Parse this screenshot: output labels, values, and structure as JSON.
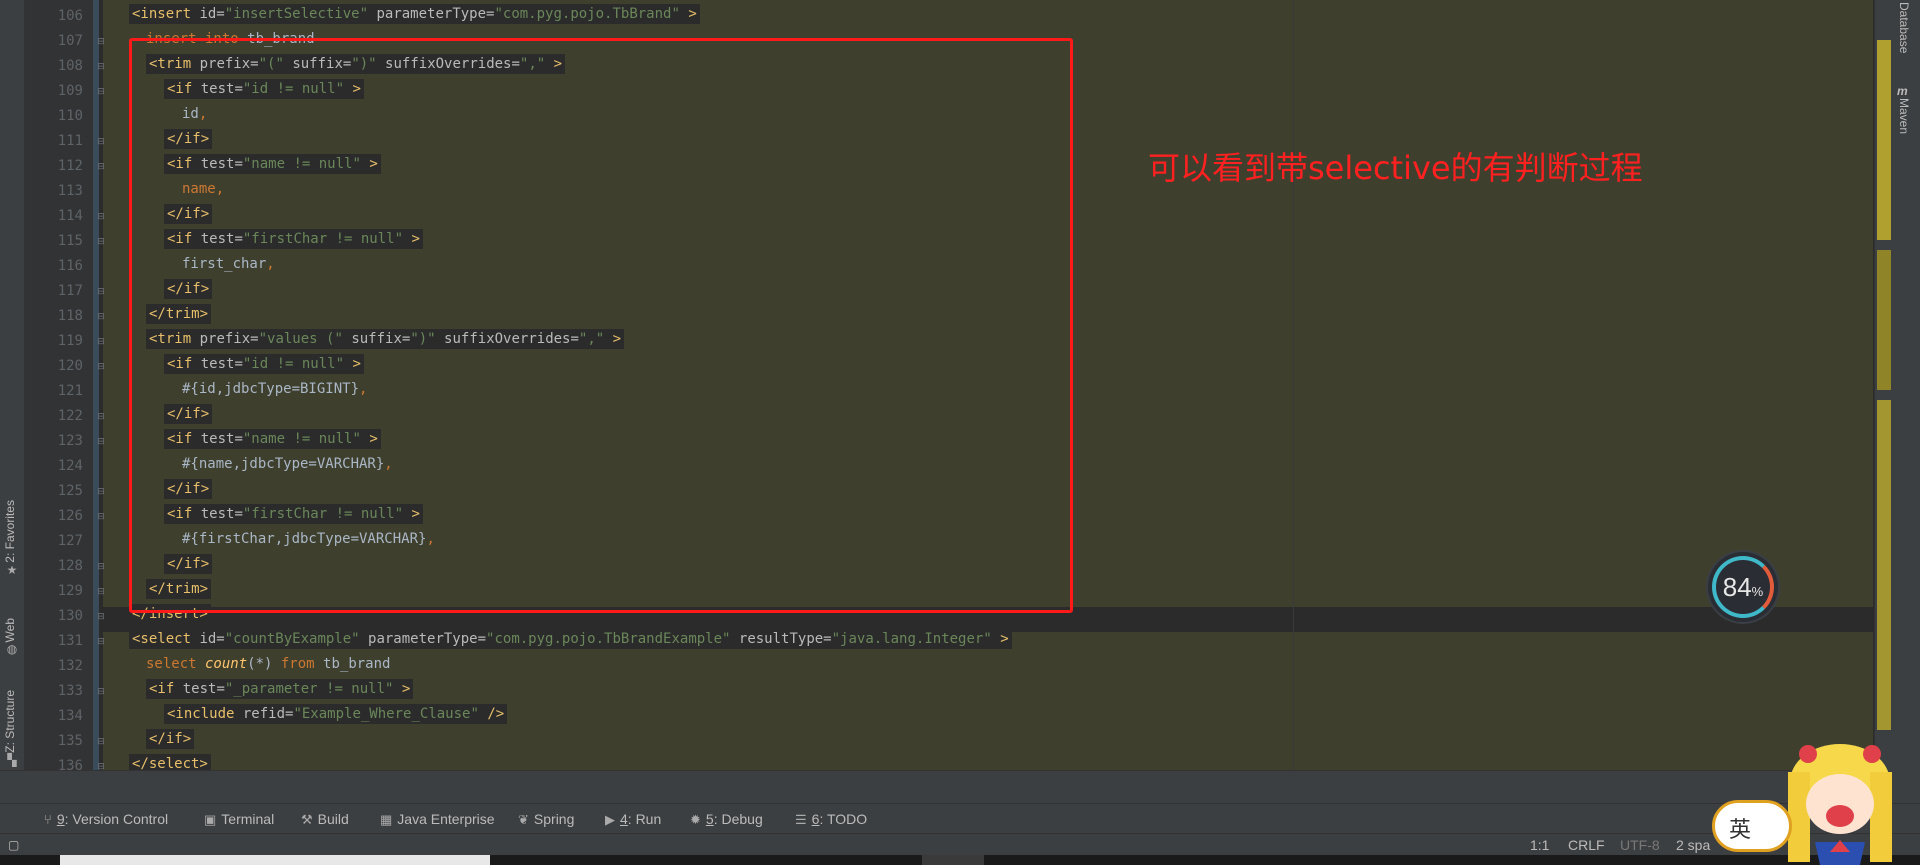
{
  "left_tool_tabs": [
    {
      "label": "2: Favorites",
      "icon": "star-icon"
    },
    {
      "label": "Web",
      "icon": "globe-icon"
    },
    {
      "label": "Z: Structure",
      "icon": "structure-icon"
    }
  ],
  "right_tool_tabs": [
    {
      "label": "Database",
      "icon": "database-icon"
    },
    {
      "label": "Maven",
      "icon": "maven-icon"
    }
  ],
  "line_numbers": [
    "106",
    "107",
    "108",
    "109",
    "110",
    "111",
    "112",
    "113",
    "114",
    "115",
    "116",
    "117",
    "118",
    "119",
    "120",
    "121",
    "122",
    "123",
    "124",
    "125",
    "126",
    "127",
    "128",
    "129",
    "130",
    "131",
    "132",
    "133",
    "134",
    "135",
    "136"
  ],
  "code": {
    "l106": {
      "a": "<insert",
      "b": " id=",
      "c": "\"insertSelective\"",
      "d": " parameterType=",
      "e": "\"com.pyg.pojo.TbBrand\"",
      "f": " >"
    },
    "l107": {
      "a": "insert into",
      "b": " tb_brand"
    },
    "l108": {
      "a": "<trim",
      "b": " prefix=",
      "c": "\"(\"",
      "d": " suffix=",
      "e": "\")\"",
      "f": " suffixOverrides=",
      "g": "\",\"",
      "h": " >"
    },
    "l109": {
      "a": "<if",
      "b": " test=",
      "c": "\"id != null\"",
      "d": " >"
    },
    "l110": {
      "a": "id",
      "b": ","
    },
    "l111": {
      "a": "</if>"
    },
    "l112": {
      "a": "<if",
      "b": " test=",
      "c": "\"name != null\"",
      "d": " >"
    },
    "l113": {
      "a": "name",
      "b": ","
    },
    "l114": {
      "a": "</if>"
    },
    "l115": {
      "a": "<if",
      "b": " test=",
      "c": "\"firstChar != null\"",
      "d": " >"
    },
    "l116": {
      "a": "first_char",
      "b": ","
    },
    "l117": {
      "a": "</if>"
    },
    "l118": {
      "a": "</trim>"
    },
    "l119": {
      "a": "<trim",
      "b": " prefix=",
      "c": "\"values (\"",
      "d": " suffix=",
      "e": "\")\"",
      "f": " suffixOverrides=",
      "g": "\",\"",
      "h": " >"
    },
    "l120": {
      "a": "<if",
      "b": " test=",
      "c": "\"id != null\"",
      "d": " >"
    },
    "l121": {
      "a": "#{id,jdbcType=BIGINT}",
      "b": ","
    },
    "l122": {
      "a": "</if>"
    },
    "l123": {
      "a": "<if",
      "b": " test=",
      "c": "\"name != null\"",
      "d": " >"
    },
    "l124": {
      "a": "#{name,jdbcType=VARCHAR}",
      "b": ","
    },
    "l125": {
      "a": "</if>"
    },
    "l126": {
      "a": "<if",
      "b": " test=",
      "c": "\"firstChar != null\"",
      "d": " >"
    },
    "l127": {
      "a": "#{firstChar,jdbcType=VARCHAR}",
      "b": ","
    },
    "l128": {
      "a": "</if>"
    },
    "l129": {
      "a": "</trim>"
    },
    "l130": {
      "a": "</insert>"
    },
    "l131": {
      "a": "<select",
      "b": " id=",
      "c": "\"countByExample\"",
      "d": " parameterType=",
      "e": "\"com.pyg.pojo.TbBrandExample\"",
      "f": " resultType=",
      "g": "\"java.lang.Integer\"",
      "h": " >"
    },
    "l132": {
      "a": "select",
      "b": " count",
      "c": "(*)",
      "d": " from",
      "e": " tb_brand"
    },
    "l133": {
      "a": "<if",
      "b": " test=",
      "c": "\"_parameter != null\"",
      "d": " >"
    },
    "l134": {
      "a": "<include",
      "b": " refid=",
      "c": "\"Example_Where_Clause\"",
      "d": " />"
    },
    "l135": {
      "a": "</if>"
    },
    "l136": {
      "a": "</select>"
    }
  },
  "annotation": "可以看到带selective的有判断过程",
  "memory_indicator": {
    "value": "84",
    "unit": "%"
  },
  "tool_windows": [
    {
      "key": "9",
      "label": ": Version Control",
      "icon": "branch-icon"
    },
    {
      "key": "",
      "label": "Terminal",
      "icon": "terminal-icon"
    },
    {
      "key": "",
      "label": "Build",
      "icon": "hammer-icon"
    },
    {
      "key": "",
      "label": "Java Enterprise",
      "icon": "java-enterprise-icon"
    },
    {
      "key": "",
      "label": "Spring",
      "icon": "spring-leaf-icon"
    },
    {
      "key": "4",
      "label": ": Run",
      "icon": "play-icon"
    },
    {
      "key": "5",
      "label": ": Debug",
      "icon": "bug-icon"
    },
    {
      "key": "6",
      "label": ": TODO",
      "icon": "list-icon"
    }
  ],
  "status": {
    "position": "1:1",
    "line_sep": "CRLF",
    "encoding": "UTF-8",
    "indent": "2 spa"
  },
  "ime": {
    "label": "英"
  },
  "colors": {
    "editor_bg": "#2b2b2b",
    "highlight": "#3f3f2e",
    "tag": "#e8bf6a",
    "string": "#6a8759",
    "keyword": "#cc7832",
    "annotation_red": "#ff2020"
  }
}
